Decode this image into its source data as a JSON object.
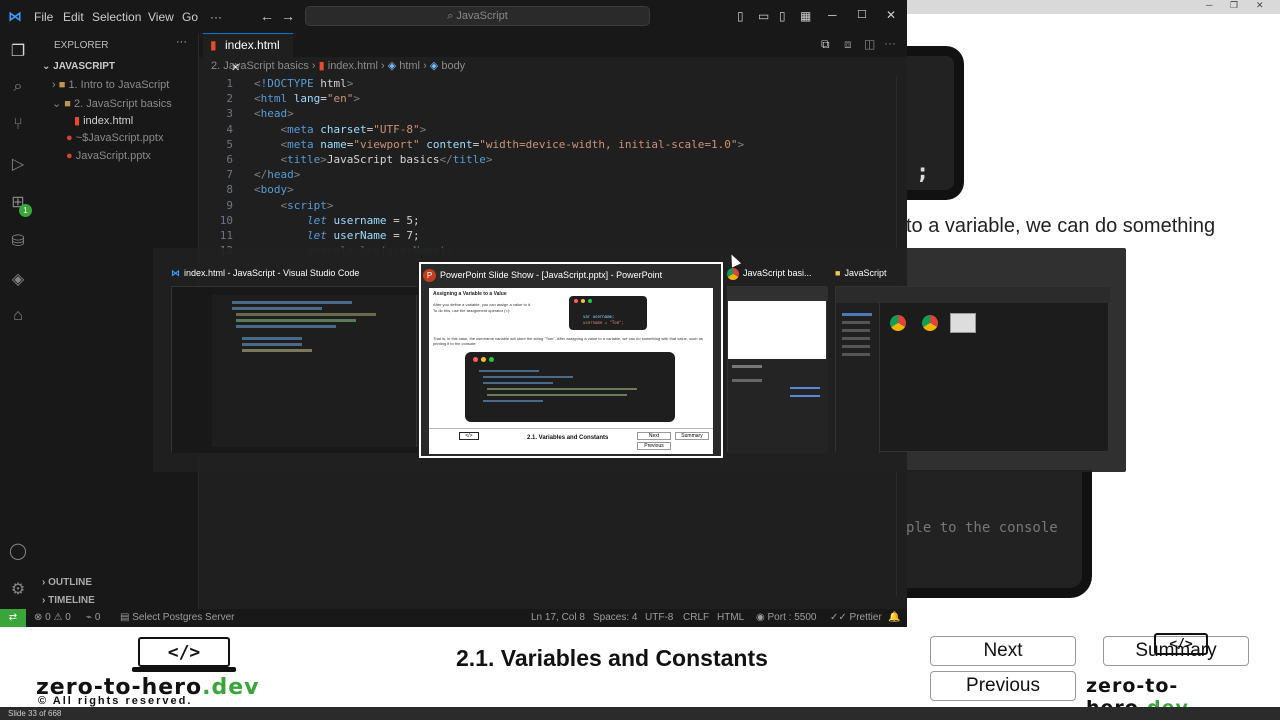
{
  "vscode": {
    "menu": [
      "File",
      "Edit",
      "Selection",
      "View",
      "Go",
      "···"
    ],
    "search_placeholder": "JavaScript",
    "explorer_title": "EXPLORER",
    "tree_root": "JAVASCRIPT",
    "tree": [
      {
        "label": "1. Intro to JavaScript",
        "kind": "folder"
      },
      {
        "label": "2. JavaScript basics",
        "kind": "folder-open"
      },
      {
        "label": "index.html",
        "kind": "html"
      },
      {
        "label": "~$JavaScript.pptx",
        "kind": "pptx"
      },
      {
        "label": "JavaScript.pptx",
        "kind": "pptx"
      }
    ],
    "outline_label": "OUTLINE",
    "timeline_label": "TIMELINE",
    "tab_label": "index.html",
    "breadcrumb": [
      "2. JavaScript basics",
      "index.html",
      "html",
      "body"
    ],
    "line_numbers": [
      "1",
      "2",
      "3",
      "4",
      "5",
      "6",
      "7",
      "8",
      "9",
      "10",
      "11",
      "12"
    ],
    "code_lines": [
      "<!DOCTYPE html>",
      "<html lang=\"en\">",
      "<head>",
      "    <meta charset=\"UTF-8\">",
      "    <meta name=\"viewport\" content=\"width=device-width, initial-scale=1.0\">",
      "    <title>JavaScript basics</title>",
      "</head>",
      "<body>",
      "    <script>",
      "        let username = 5;",
      "        let userName = 7;",
      "        console.log(userName);"
    ],
    "status": {
      "errors": "0",
      "warnings": "0",
      "ports": "0",
      "postgres": "Select Postgres Server",
      "cursor": "Ln 17, Col 8",
      "spaces": "Spaces: 4",
      "encoding": "UTF-8",
      "eol": "CRLF",
      "language": "HTML",
      "port": "Port : 5500",
      "prettier": "Prettier"
    },
    "notification_badge": "1"
  },
  "switcher": {
    "windows": [
      {
        "title": "index.html - JavaScript - Visual Studio Code",
        "app": "vscode"
      },
      {
        "title": "PowerPoint Slide Show - [JavaScript.pptx] - PowerPoint",
        "app": "powerpoint",
        "selected": true
      },
      {
        "title": "JavaScript basi...",
        "app": "chrome"
      },
      {
        "title": "JavaScript",
        "app": "explorer"
      }
    ],
    "ppt_thumb": {
      "heading": "Assigning a Variable to a Value",
      "text1": "After you define a variable, you can assign a value to it.",
      "text2": "To do this, use the assignment operator (=):",
      "code1": [
        "var username;",
        "username = \"Tom\";"
      ],
      "text3": "That is, in this case, the username variable will store the string \"Tom\". After assigning a value to a variable, we can do something with that value, such as printing it to the console:",
      "slide_title": "2.1. Variables and Constants",
      "next": "Next",
      "previous": "Previous",
      "summary": "Summary"
    }
  },
  "ppt": {
    "visible_text": "to a variable, we can do something",
    "console_text": "ple to the console",
    "code_fragment": ";",
    "slide_title": "2.1. Variables and Constants",
    "logo_text": "zero-to-hero",
    "logo_dev": ".dev",
    "logo_copy": "© All rights reserved.",
    "logo_tag": "</>",
    "next": "Next",
    "previous": "Previous",
    "summary": "Summary",
    "slide_counter": "Slide 33 of 668"
  }
}
